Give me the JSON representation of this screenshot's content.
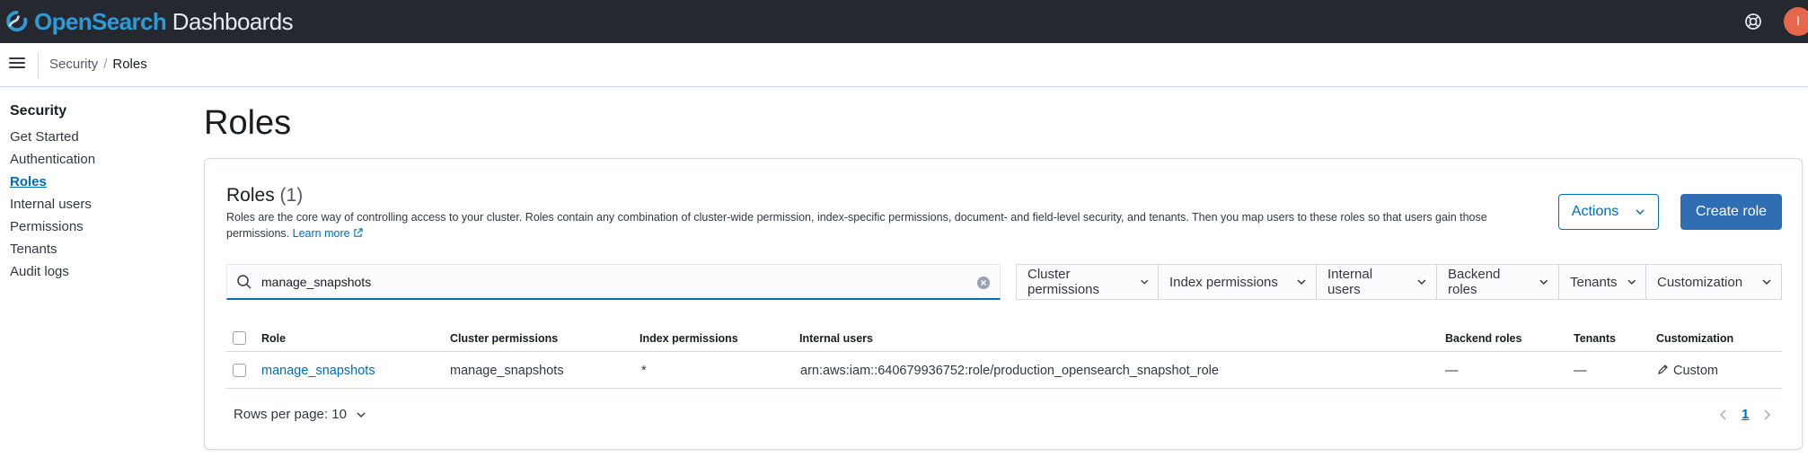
{
  "header": {
    "logo_part1": "OpenSearch",
    "logo_part2": "Dashboards",
    "avatar_initial": "I",
    "help_icon": "help-icon"
  },
  "breadcrumb": [
    "Security",
    "Roles"
  ],
  "sidebar": {
    "title": "Security",
    "items": [
      {
        "label": "Get Started",
        "active": false
      },
      {
        "label": "Authentication",
        "active": false
      },
      {
        "label": "Roles",
        "active": true
      },
      {
        "label": "Internal users",
        "active": false
      },
      {
        "label": "Permissions",
        "active": false
      },
      {
        "label": "Tenants",
        "active": false
      },
      {
        "label": "Audit logs",
        "active": false
      }
    ]
  },
  "page": {
    "title": "Roles"
  },
  "panel": {
    "title": "Roles",
    "count": "(1)",
    "description": "Roles are the core way of controlling access to your cluster. Roles contain any combination of cluster-wide permission, index-specific permissions, document- and field-level security, and tenants. Then you map users to these roles so that users gain those permissions.",
    "learn_more": "Learn more",
    "actions_label": "Actions",
    "create_label": "Create role"
  },
  "search": {
    "value": "manage_snapshots",
    "placeholder": "Search"
  },
  "filters": [
    "Cluster permissions",
    "Index permissions",
    "Internal users",
    "Backend roles",
    "Tenants",
    "Customization"
  ],
  "table": {
    "columns": [
      "Role",
      "Cluster permissions",
      "Index permissions",
      "Internal users",
      "Backend roles",
      "Tenants",
      "Customization"
    ],
    "rows": [
      {
        "role": "manage_snapshots",
        "cluster_permissions": "manage_snapshots",
        "index_permissions": "*",
        "internal_users": "arn:aws:iam::640679936752:role/production_opensearch_snapshot_role",
        "backend_roles": "—",
        "tenants": "—",
        "customization": "Custom"
      }
    ]
  },
  "pagination": {
    "rows_per_page": "Rows per page: 10",
    "current_page": "1"
  },
  "colors": {
    "topbar": "#25282f",
    "link": "#006bb8",
    "primary_button": "#2f6eb3",
    "avatar": "#e7664c"
  }
}
